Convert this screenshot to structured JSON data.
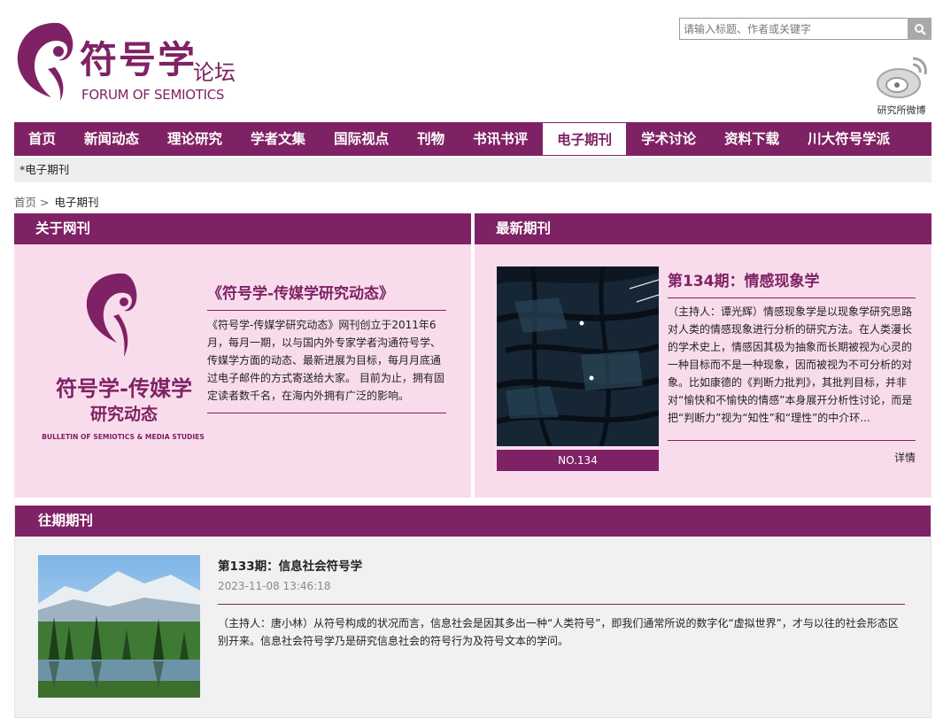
{
  "header": {
    "logo": {
      "title": "符号学",
      "subtitle": "论坛",
      "english": "FORUM OF SEMIOTICS"
    },
    "search_placeholder": "请输入标题、作者或关键字",
    "weibo_label": "研究所微博"
  },
  "nav": {
    "items": [
      {
        "label": "首页"
      },
      {
        "label": "新闻动态"
      },
      {
        "label": "理论研究"
      },
      {
        "label": "学者文集"
      },
      {
        "label": "国际视点"
      },
      {
        "label": "刊物"
      },
      {
        "label": "书讯书评"
      },
      {
        "label": "电子期刊",
        "active": true
      },
      {
        "label": "学术讨论"
      },
      {
        "label": "资料下载"
      },
      {
        "label": "川大符号学派"
      }
    ]
  },
  "subbar": "*电子期刊",
  "breadcrumb": {
    "home": "首页",
    "sep": ">",
    "current": "电子期刊"
  },
  "about": {
    "heading": "关于网刊",
    "logo_cn_1": "符号学-传媒学",
    "logo_cn_2": "研究动态",
    "logo_en": "BULLETIN OF SEMIOTICS & MEDIA STUDIES",
    "title": "《符号学-传媒学研究动态》",
    "text": "《符号学-传媒学研究动态》网刊创立于2011年6月，每月一期，以与国内外专家学者沟通符号学、传媒学方面的动态、最新进展为目标，每月月底通过电子邮件的方式寄送给大家。 目前为止，拥有固定读者数千名，在海内外拥有广泛的影响。"
  },
  "latest": {
    "heading": "最新期刊",
    "issue_no": "NO.134",
    "title": "第134期：情感现象学",
    "text": "（主持人：谭光辉）情感现象学是以现象学研究思路对人类的情感现象进行分析的研究方法。在人类漫长的学术史上，情感因其极为抽象而长期被视为心灵的一种目标而不是一种现象，因而被视为不可分析的对象。比如康德的《判断力批判》，其批判目标，并非对“愉快和不愉快的情感”本身展开分析性讨论，而是把“判断力”视为“知性”和“理性”的中介环...",
    "more": "详情"
  },
  "past": {
    "heading": "往期期刊",
    "items": [
      {
        "title": "第133期：信息社会符号学",
        "date": "2023-11-08 13:46:18",
        "text": "（主持人：唐小林）从符号构成的状况而言，信息社会是因其多出一种“人类符号”，即我们通常所说的数字化“虚拟世界”，才与以往的社会形态区别开来。信息社会符号学乃是研究信息社会的符号行为及符号文本的学问。"
      }
    ]
  },
  "colors": {
    "brand": "#7f2265",
    "panel_pink": "#f9dcec",
    "panel_gray": "#f1f1f1"
  }
}
